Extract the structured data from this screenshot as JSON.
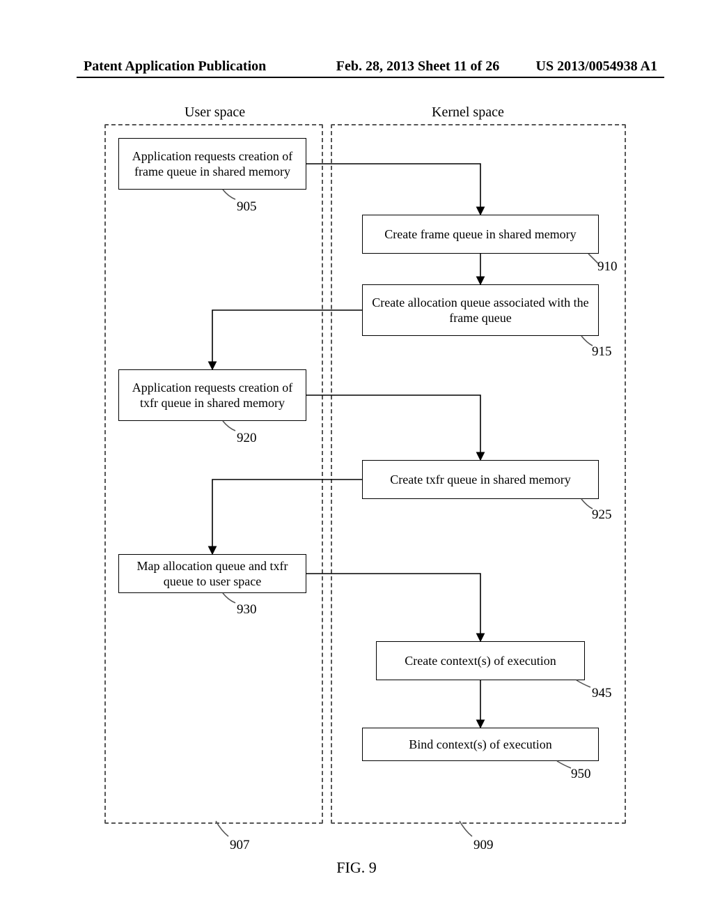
{
  "header": {
    "left": "Patent Application Publication",
    "date": "Feb. 28, 2013  Sheet 11 of 26",
    "right": "US 2013/0054938 A1"
  },
  "columns": {
    "user": "User space",
    "kernel": "Kernel space"
  },
  "boxes": {
    "b905": "Application requests creation of frame queue in shared memory",
    "b910": "Create frame queue in shared memory",
    "b915": "Create allocation queue associated with the frame queue",
    "b920": "Application requests creation of txfr queue in shared memory",
    "b925": "Create txfr queue in shared memory",
    "b930": "Map allocation queue and txfr queue to user space",
    "b945": "Create context(s) of execution",
    "b950": "Bind context(s) of execution"
  },
  "refs": {
    "r905": "905",
    "r910": "910",
    "r915": "915",
    "r920": "920",
    "r925": "925",
    "r930": "930",
    "r945": "945",
    "r950": "950",
    "r907": "907",
    "r909": "909"
  },
  "figure": "FIG. 9"
}
